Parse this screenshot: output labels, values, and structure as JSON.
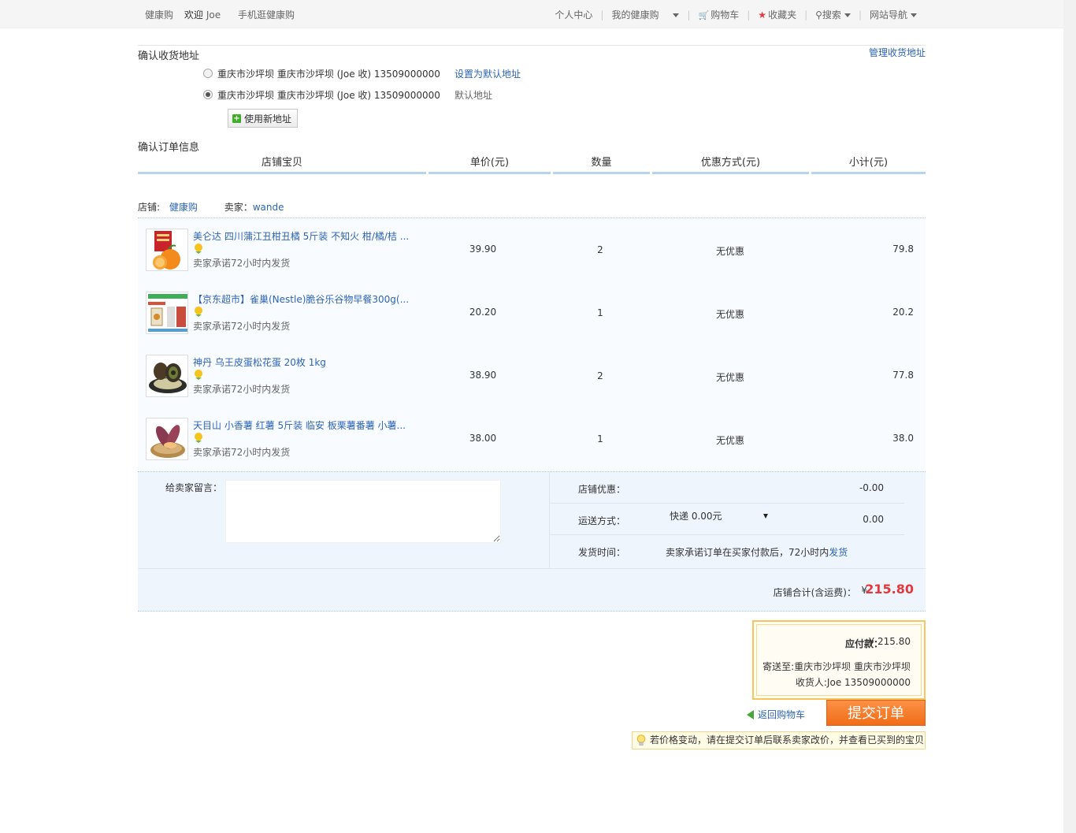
{
  "topbar": {
    "site": "健康购",
    "welcome": "欢迎",
    "user": "Joe",
    "mobile": "手机逛健康购",
    "personal_center": "个人中心",
    "my_site": "我的健康购",
    "cart": "购物车",
    "favorites": "收藏夹",
    "search": "搜索",
    "site_nav": "网站导航"
  },
  "address": {
    "title": "确认收货地址",
    "manage_link": "管理收货地址",
    "options": [
      {
        "text": "重庆市沙坪坝 重庆市沙坪坝 (Joe 收) 13509000000",
        "action": "设置为默认地址",
        "selected": false
      },
      {
        "text": "重庆市沙坪坝 重庆市沙坪坝 (Joe 收) 13509000000",
        "action": "默认地址",
        "selected": true
      }
    ],
    "new_button": "使用新地址"
  },
  "order": {
    "title": "确认订单信息",
    "headers": [
      "店铺宝贝",
      "单价(元)",
      "数量",
      "优惠方式(元)",
      "小计(元)"
    ],
    "shop_label": "店铺:",
    "shop_name": "健康购",
    "seller_label": "卖家：",
    "seller_name": "wande",
    "items": [
      {
        "name": "美仑达 四川蒲江丑柑丑橘 5斤装 不知火 柑/橘/桔 ...",
        "promise": "卖家承诺72小时内发货",
        "price": "39.90",
        "qty": "2",
        "discount": "无优惠",
        "subtotal": "79.8"
      },
      {
        "name": "【京东超市】雀巢(Nestle)脆谷乐谷物早餐300g(...",
        "promise": "卖家承诺72小时内发货",
        "price": "20.20",
        "qty": "1",
        "discount": "无优惠",
        "subtotal": "20.2"
      },
      {
        "name": "神丹 乌王皮蛋松花蛋 20枚 1kg",
        "promise": "卖家承诺72小时内发货",
        "price": "38.90",
        "qty": "2",
        "discount": "无优惠",
        "subtotal": "77.8"
      },
      {
        "name": "天目山 小香薯 红薯 5斤装 临安 板栗薯番薯 小薯...",
        "promise": "卖家承诺72小时内发货",
        "price": "38.00",
        "qty": "1",
        "discount": "无优惠",
        "subtotal": "38.0"
      }
    ],
    "message_label": "给卖家留言：",
    "shop_discount_label": "店铺优惠：",
    "shop_discount_value": "-0.00",
    "shipping_label": "运送方式：",
    "shipping_select": "快递 0.00元",
    "shipping_value": "0.00",
    "ship_time_label": "发货时间：",
    "ship_time_text": "卖家承诺订单在买家付款后，72小时内",
    "ship_time_link": "发货",
    "total_label": "店铺合计(含运费)：",
    "total_currency": "¥",
    "total_value": "215.80"
  },
  "payment": {
    "label": "应付款：",
    "value": "¥ 215.80",
    "ship_to": "寄送至:重庆市沙坪坝 重庆市沙坪坝",
    "receiver": "收货人:Joe 13509000000",
    "back_to_cart": "返回购物车",
    "submit": "提交订单",
    "tip": "若价格变动，请在提交订单后联系卖家改价，并查看已买到的宝贝"
  },
  "colors": {
    "accent": "#f16d17",
    "link": "#2d64b3",
    "price_red": "#e4393c"
  }
}
